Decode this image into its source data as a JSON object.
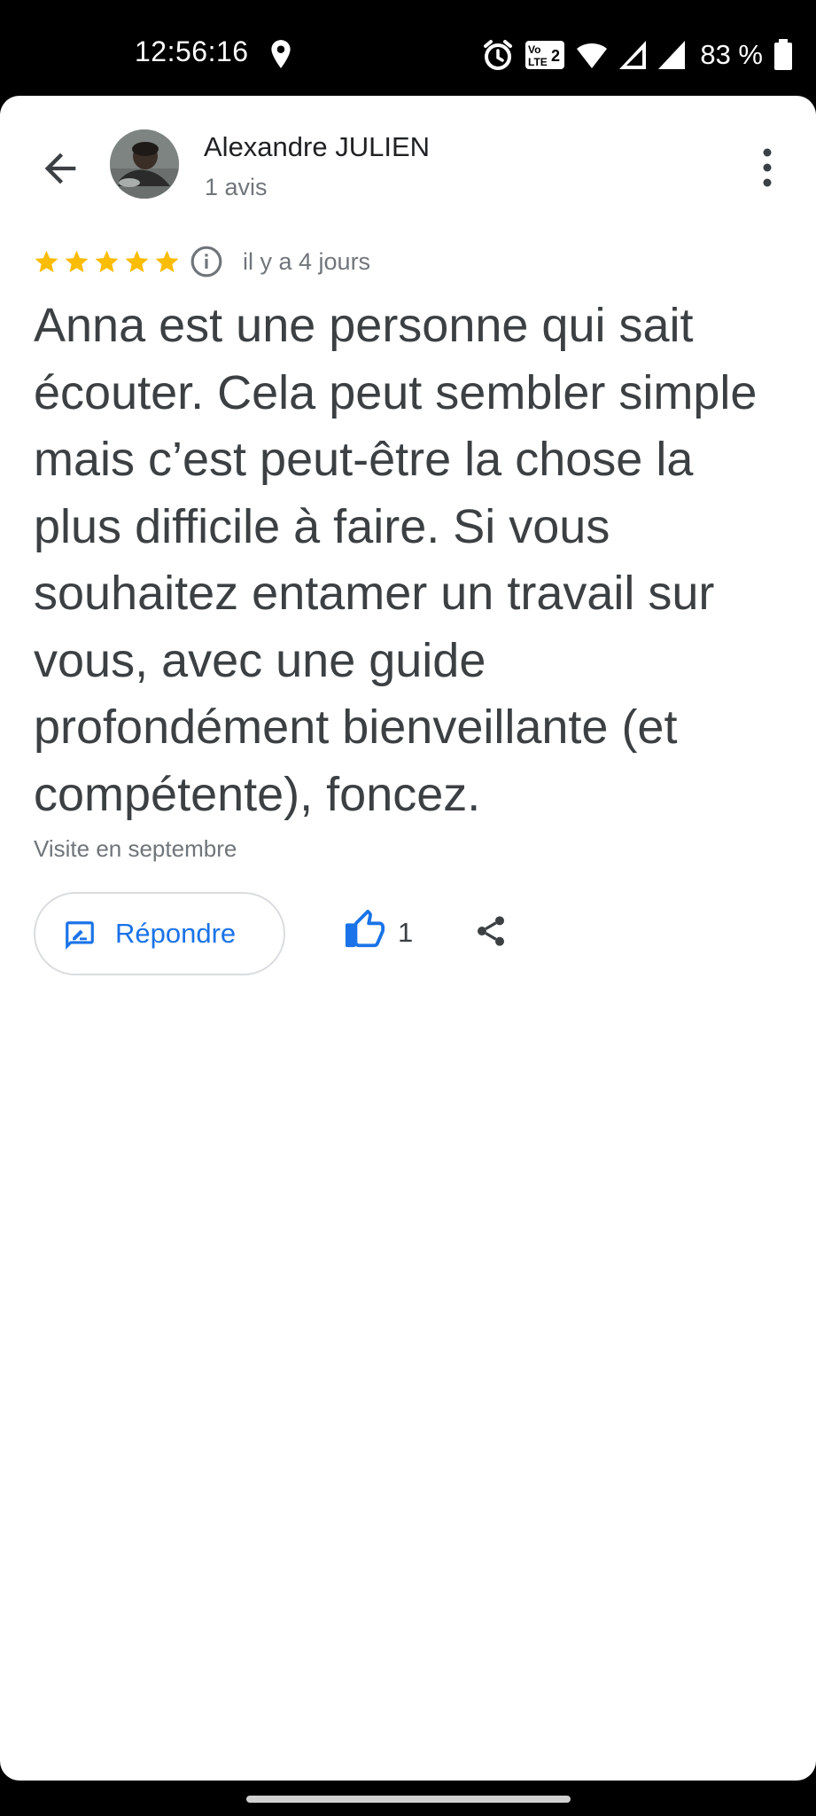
{
  "status_bar": {
    "time": "12:56:16",
    "battery_percent": "83 %",
    "icons": [
      "location-icon",
      "alarm-icon",
      "volte-icon",
      "wifi-icon",
      "signal-icon",
      "signal-icon",
      "battery-icon"
    ]
  },
  "reviewer": {
    "name": "Alexandre JULIEN",
    "review_count": "1 avis"
  },
  "review": {
    "rating": 5,
    "max_rating": 5,
    "date": "il y a 4 jours",
    "text": "Anna est une personne qui sait écouter. Cela peut sembler simple mais c’est peut-être la chose la plus difficile à faire. Si vous souhaitez entamer un travail sur vous, avec une guide profondément bienveillante (et compétente), foncez.",
    "visit": "Visite en septembre"
  },
  "actions": {
    "reply_label": "Répondre",
    "like_count": "1"
  },
  "colors": {
    "accent": "#1a73e8",
    "star": "#fbbc04",
    "text_primary": "#3c4043",
    "text_secondary": "#70757a"
  }
}
